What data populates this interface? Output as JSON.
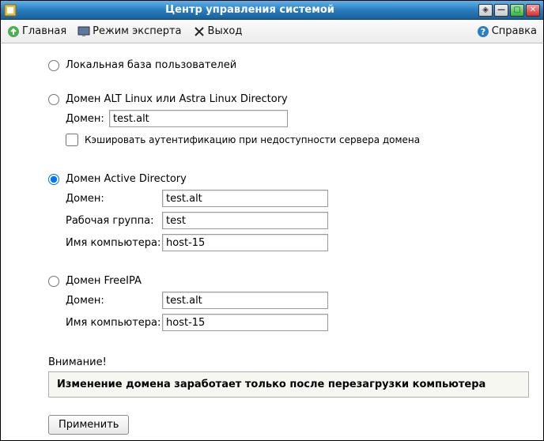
{
  "window": {
    "title": "Центр управления системой"
  },
  "toolbar": {
    "home": "Главная",
    "expert": "Режим эксперта",
    "exit": "Выход",
    "help": "Справка"
  },
  "auth": {
    "local": {
      "label": "Локальная база пользователей"
    },
    "alt": {
      "label": "Домен ALT Linux или Astra Linux Directory",
      "domain_label": "Домен:",
      "domain_value": "test.alt",
      "cache_label": "Кэшировать аутентификацию при недоступности сервера домена"
    },
    "ad": {
      "label": "Домен Active Directory",
      "domain_label": "Домен:",
      "domain_value": "test.alt",
      "workgroup_label": "Рабочая группа:",
      "workgroup_value": "test",
      "hostname_label": "Имя компьютера:",
      "hostname_value": "host-15"
    },
    "ipa": {
      "label": "Домен FreeIPA",
      "domain_label": "Домен:",
      "domain_value": "test.alt",
      "hostname_label": "Имя компьютера:",
      "hostname_value": "host-15"
    }
  },
  "warning": {
    "title": "Внимание!",
    "text": "Изменение домена заработает только после перезагрузки компьютера"
  },
  "actions": {
    "apply": "Применить"
  }
}
